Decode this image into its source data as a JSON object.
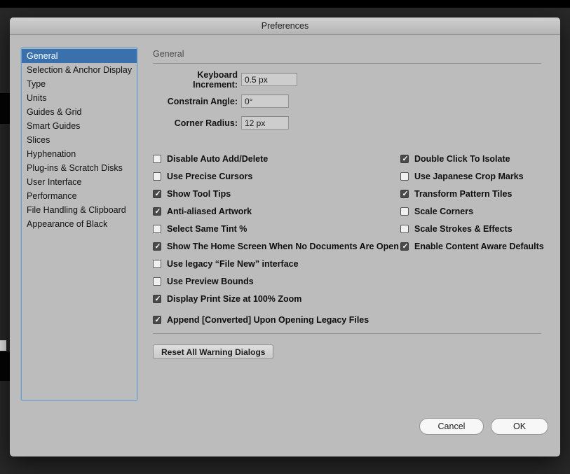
{
  "window": {
    "title": "Preferences"
  },
  "icons": {
    "checkmark": "✓"
  },
  "colors": {
    "selection_blue": "#3a71ad",
    "sidebar_focus_border": "#6aa0cf",
    "dialog_background": "#bcbcbc",
    "checked_box_fill": "#4a4a4a"
  },
  "sidebar": {
    "items": [
      {
        "label": "General",
        "selected": true
      },
      {
        "label": "Selection & Anchor Display",
        "selected": false
      },
      {
        "label": "Type",
        "selected": false
      },
      {
        "label": "Units",
        "selected": false
      },
      {
        "label": "Guides & Grid",
        "selected": false
      },
      {
        "label": "Smart Guides",
        "selected": false
      },
      {
        "label": "Slices",
        "selected": false
      },
      {
        "label": "Hyphenation",
        "selected": false
      },
      {
        "label": "Plug-ins & Scratch Disks",
        "selected": false
      },
      {
        "label": "User Interface",
        "selected": false
      },
      {
        "label": "Performance",
        "selected": false
      },
      {
        "label": "File Handling & Clipboard",
        "selected": false
      },
      {
        "label": "Appearance of Black",
        "selected": false
      }
    ]
  },
  "panel": {
    "section_title": "General",
    "fields": [
      {
        "label": "Keyboard Increment:",
        "value": "0.5 px",
        "width": 80
      },
      {
        "label": "Constrain Angle:",
        "value": "0°",
        "width": 68
      },
      {
        "label": "Corner Radius:",
        "value": "12 px",
        "width": 68
      }
    ],
    "checkboxes_left": [
      {
        "label": "Disable Auto Add/Delete",
        "checked": false
      },
      {
        "label": "Use Precise Cursors",
        "checked": false
      },
      {
        "label": "Show Tool Tips",
        "checked": true
      },
      {
        "label": "Anti-aliased Artwork",
        "checked": true
      },
      {
        "label": "Select Same Tint %",
        "checked": false
      },
      {
        "label": "Show The Home Screen When No Documents Are Open",
        "checked": true
      },
      {
        "label": "Use legacy “File New” interface",
        "checked": false
      },
      {
        "label": "Use Preview Bounds",
        "checked": false
      },
      {
        "label": "Display Print Size at 100% Zoom",
        "checked": true
      },
      {
        "label": "Append [Converted] Upon Opening Legacy Files",
        "checked": true
      }
    ],
    "checkboxes_right": [
      {
        "label": "Double Click To Isolate",
        "checked": true
      },
      {
        "label": "Use Japanese Crop Marks",
        "checked": false
      },
      {
        "label": "Transform Pattern Tiles",
        "checked": true
      },
      {
        "label": "Scale Corners",
        "checked": false
      },
      {
        "label": "Scale Strokes & Effects",
        "checked": false
      },
      {
        "label": "Enable Content Aware Defaults",
        "checked": true
      }
    ],
    "reset_button": "Reset All Warning Dialogs"
  },
  "footer": {
    "cancel_label": "Cancel",
    "ok_label": "OK"
  }
}
